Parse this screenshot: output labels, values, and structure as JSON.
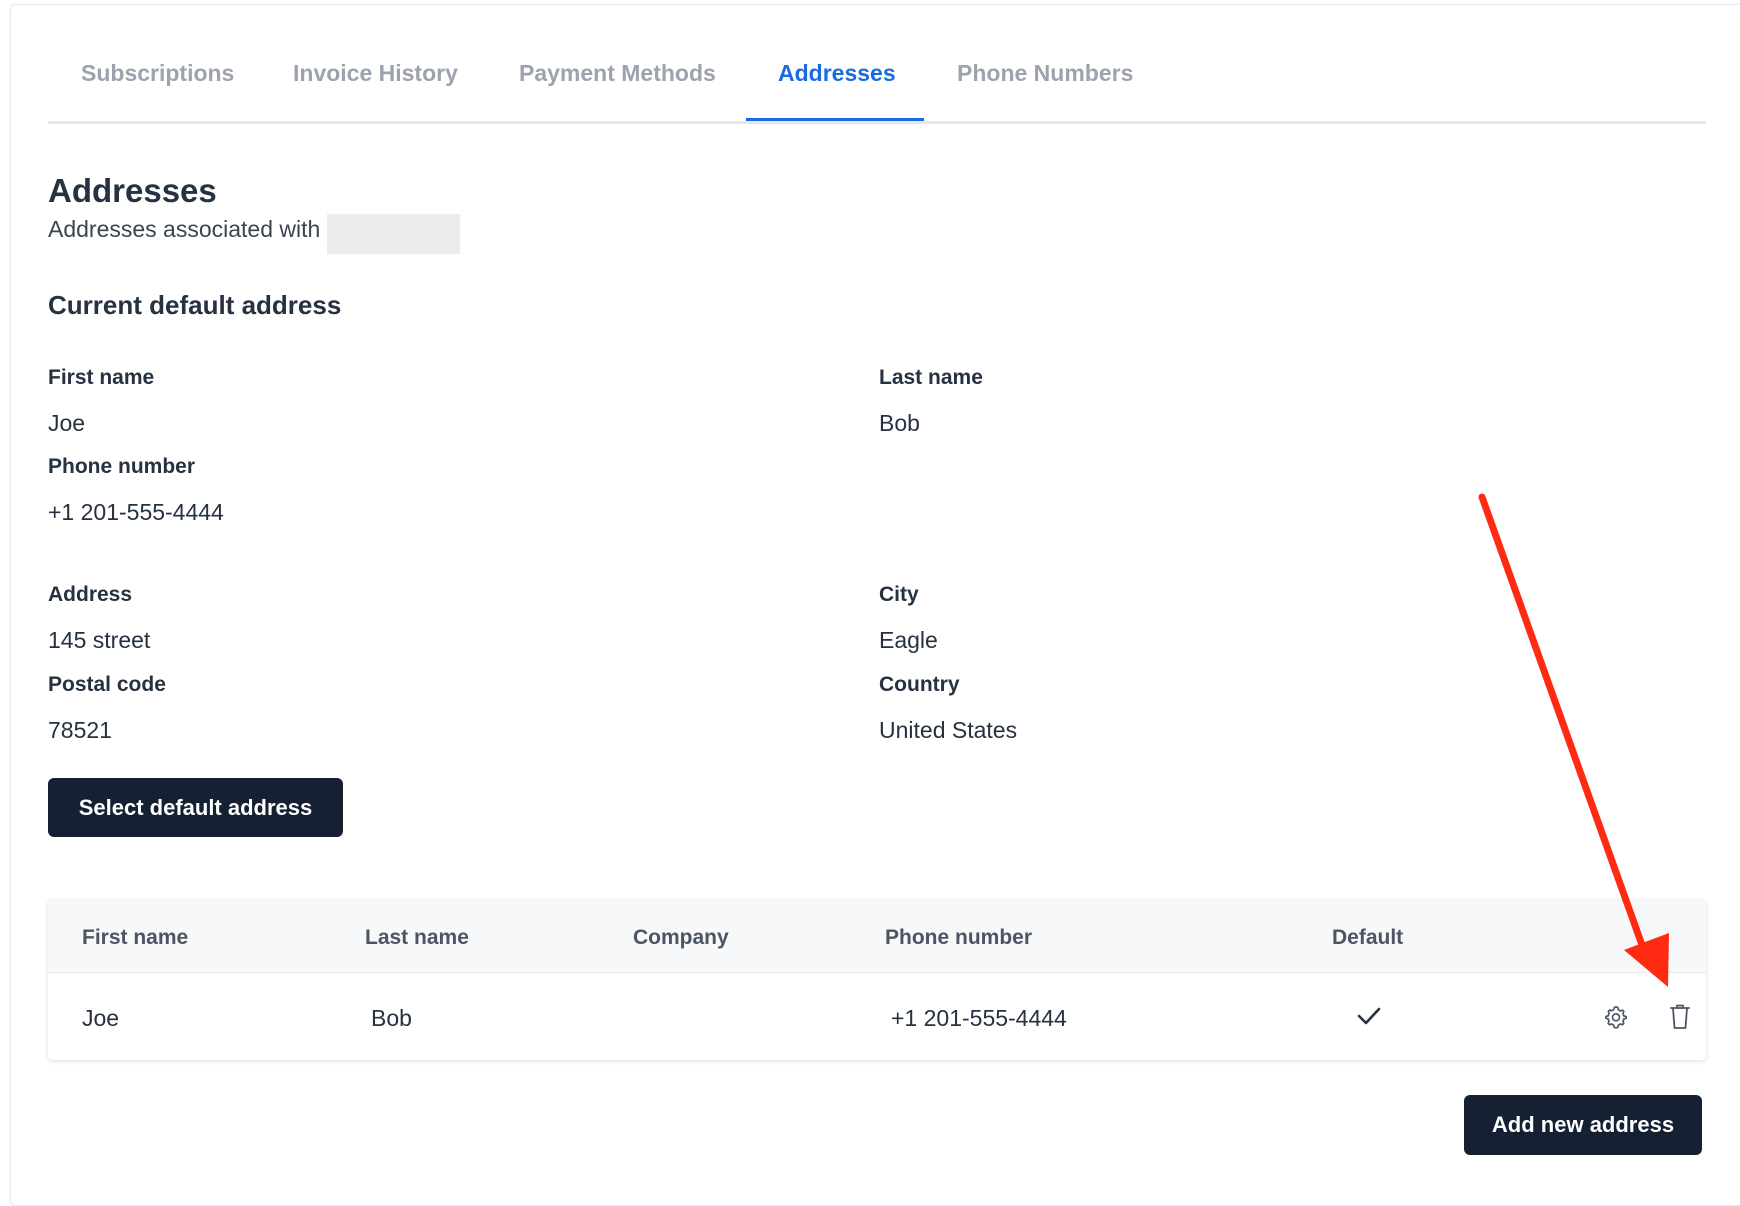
{
  "tabs": [
    {
      "label": "Subscriptions",
      "active": false
    },
    {
      "label": "Invoice History",
      "active": false
    },
    {
      "label": "Payment Methods",
      "active": false
    },
    {
      "label": "Addresses",
      "active": true
    },
    {
      "label": "Phone Numbers",
      "active": false
    }
  ],
  "page": {
    "title": "Addresses",
    "subtitle": "Addresses associated with"
  },
  "default_address": {
    "section_title": "Current default address",
    "first_name_label": "First name",
    "first_name": "Joe",
    "last_name_label": "Last name",
    "last_name": "Bob",
    "phone_label": "Phone number",
    "phone": "+1 201-555-4444",
    "address_label": "Address",
    "address": "145 street",
    "city_label": "City",
    "city": "Eagle",
    "postal_label": "Postal code",
    "postal": "78521",
    "country_label": "Country",
    "country": "United States",
    "select_button": "Select default address"
  },
  "table": {
    "headers": [
      "First name",
      "Last name",
      "Company",
      "Phone number",
      "Default"
    ],
    "rows": [
      {
        "first_name": "Joe",
        "last_name": "Bob",
        "company": "",
        "phone": "+1 201-555-4444",
        "default": true
      }
    ]
  },
  "add_button": "Add new address",
  "icons": {
    "default": "checkmark-icon",
    "settings": "gear-icon",
    "delete": "trash-icon",
    "annotation": "red-arrow"
  },
  "colors": {
    "accent": "#1a6be0",
    "button": "#152033",
    "annotation": "#ff2a12"
  }
}
